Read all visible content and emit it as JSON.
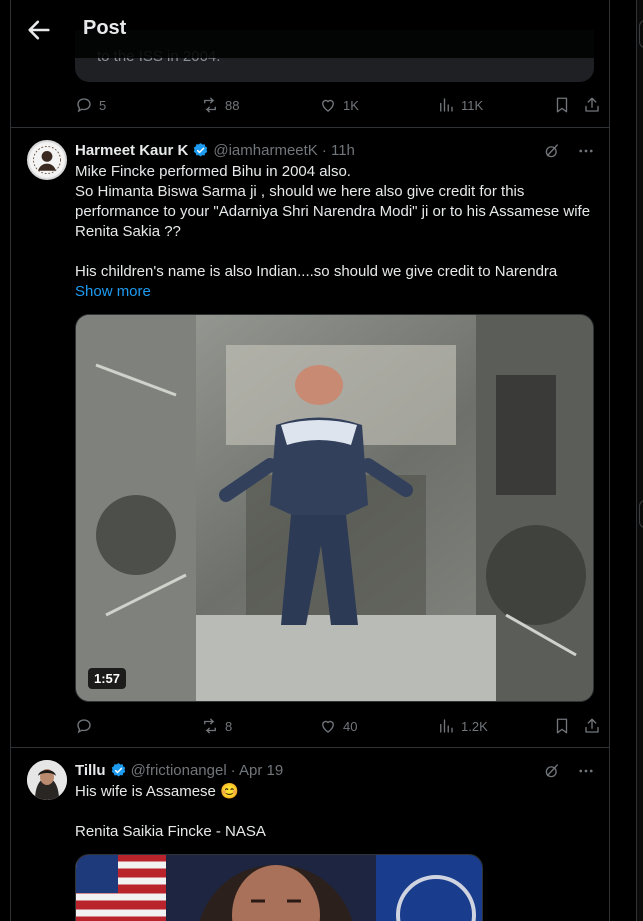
{
  "header": {
    "title": "Post"
  },
  "quoted_tail": {
    "text": "to the ISS in 2004."
  },
  "top_actions": {
    "replies": "5",
    "reposts": "88",
    "likes": "1K",
    "views": "11K"
  },
  "tweet1": {
    "name": "Harmeet Kaur K",
    "handle": "@iamharmeetK",
    "time": "· 11h",
    "text": "Mike Fincke performed Bihu in 2004 also.\nSo Himanta Biswa Sarma ji , should we here also give credit for this performance to your \"Adarniya Shri Narendra Modi\" ji or to his Assamese wife Renita Sakia ??\n\nHis children's name is also Indian....so should we give credit to Narendra",
    "show_more": "Show more",
    "video_duration": "1:57",
    "actions": {
      "replies": "",
      "reposts": "8",
      "likes": "40",
      "views": "1.2K"
    }
  },
  "tweet2": {
    "name": "Tillu",
    "handle": "@frictionangel",
    "time": "· Apr 19",
    "line1": "His wife is Assamese 😊",
    "line2": "Renita Saikia Fincke - NASA"
  },
  "colors": {
    "accent": "#1d9bf0",
    "muted": "#71767b",
    "border": "#2f3336",
    "bg": "#000000"
  }
}
